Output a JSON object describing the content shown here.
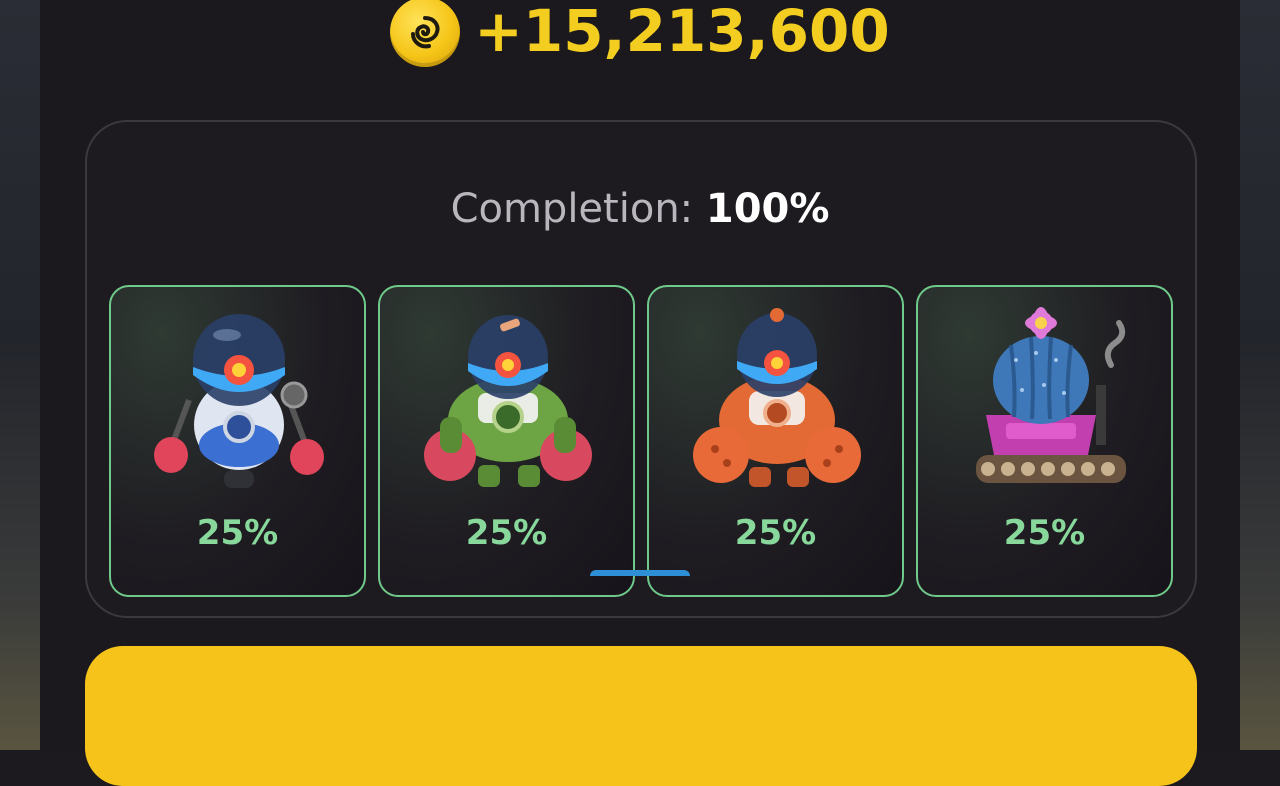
{
  "reward": {
    "icon": "coin-icon",
    "amount": "+15,213,600",
    "color": "#f3cd1f"
  },
  "completion": {
    "label": "Completion:",
    "value": "100%"
  },
  "cards": [
    {
      "name": "blue-robot-boxer",
      "icon": "robot-boxer-icon",
      "percent": "25%"
    },
    {
      "name": "green-mech-robot",
      "icon": "green-mech-icon",
      "percent": "25%"
    },
    {
      "name": "orange-mech-robot",
      "icon": "orange-mech-icon",
      "percent": "25%"
    },
    {
      "name": "cactus-tank",
      "icon": "cactus-tank-icon",
      "percent": "25%"
    }
  ],
  "colors": {
    "accent": "#f6c31b",
    "card_border": "#6fc98a",
    "percent_text": "#88d89c"
  }
}
